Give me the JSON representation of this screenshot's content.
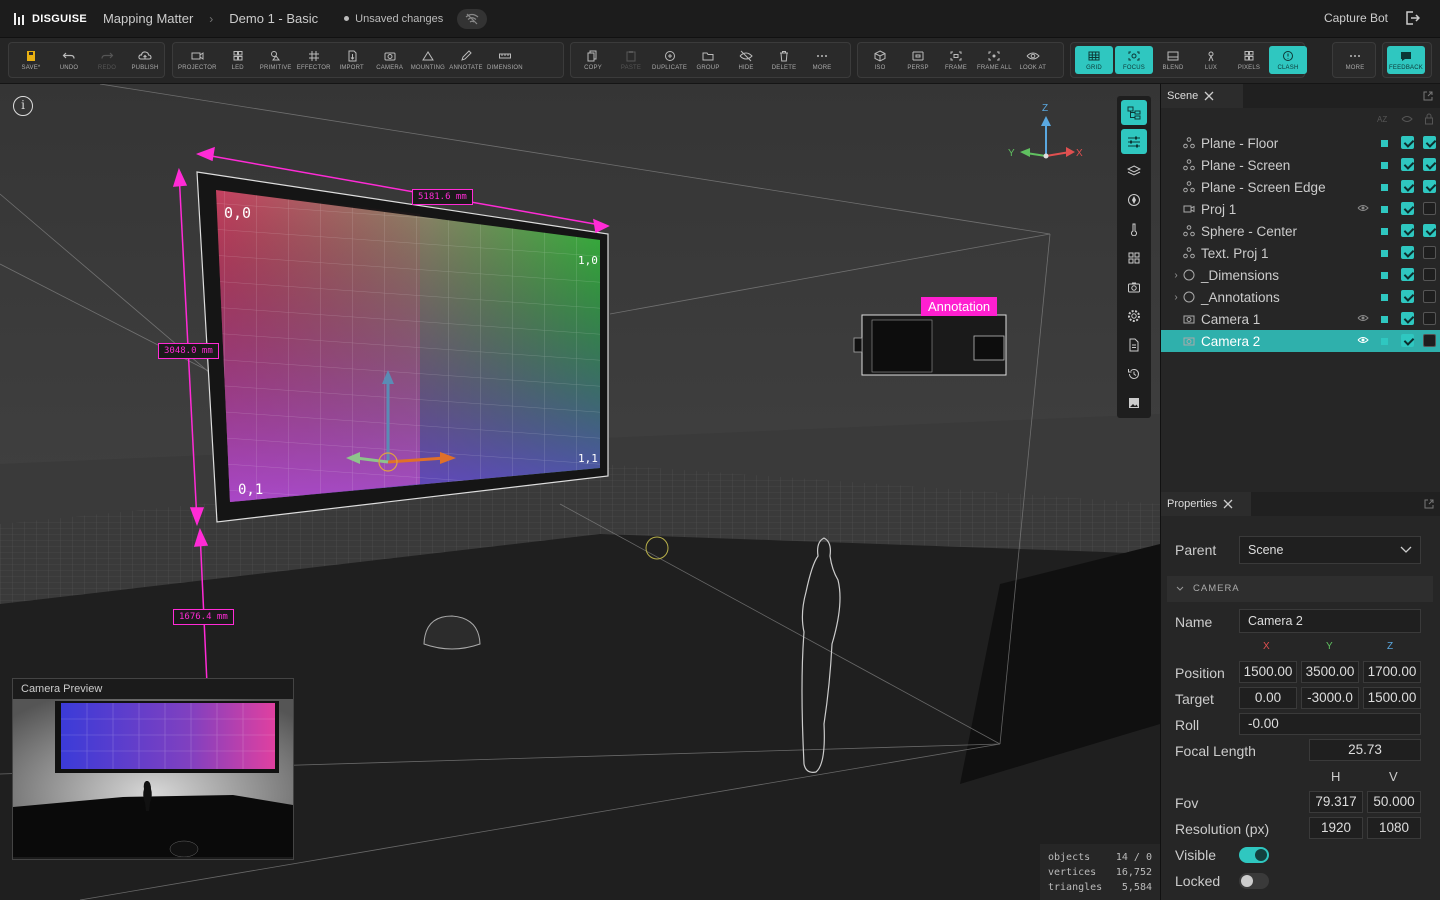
{
  "app": {
    "logo": "DISGUISE",
    "project": "Mapping Matter",
    "scene": "Demo 1 - Basic",
    "status": "Unsaved changes",
    "user": "Capture Bot"
  },
  "toolbar": {
    "file": [
      "SAVE*",
      "UNDO",
      "REDO",
      "PUBLISH"
    ],
    "create": [
      "PROJECTOR",
      "LED",
      "PRIMITIVE",
      "EFFECTOR",
      "IMPORT",
      "CAMERA",
      "MOUNTING",
      "ANNOTATE",
      "DIMENSION"
    ],
    "edit": [
      "COPY",
      "PASTE",
      "DUPLICATE",
      "GROUP",
      "HIDE",
      "DELETE",
      "MORE"
    ],
    "view": [
      "ISO",
      "PERSP",
      "FRAME",
      "FRAME ALL",
      "LOOK AT"
    ],
    "display": [
      "GRID",
      "FOCUS",
      "BLEND",
      "LUX",
      "PIXELS",
      "CLASH"
    ],
    "more": "MORE",
    "feedback": "FEEDBACK"
  },
  "viewport": {
    "dimensions": [
      "5181.6 mm",
      "3048.0 mm",
      "1676.4 mm"
    ],
    "annotation": "Annotation",
    "gizmo_axes": [
      "Z",
      "Y",
      "X"
    ],
    "screen_corner_labels": [
      "0,0",
      "1,0",
      "0,1",
      "1,1"
    ],
    "preview_title": "Camera Preview",
    "stats": [
      {
        "label": "objects",
        "value": "14 / 0"
      },
      {
        "label": "vertices",
        "value": "16,752"
      },
      {
        "label": "triangles",
        "value": "5,584"
      }
    ]
  },
  "scene_panel": {
    "tab": "Scene",
    "sort_label": "AZ",
    "items": [
      {
        "label": "Plane - Floor",
        "icon": "mesh-icon",
        "vis": true,
        "lock": true
      },
      {
        "label": "Plane - Screen",
        "icon": "mesh-icon",
        "vis": true,
        "lock": true
      },
      {
        "label": "Plane - Screen Edge",
        "icon": "mesh-icon",
        "vis": true,
        "lock": true
      },
      {
        "label": "Proj 1",
        "icon": "projector-icon",
        "eye": true,
        "vis": true,
        "lock": false
      },
      {
        "label": "Sphere - Center",
        "icon": "mesh-icon",
        "vis": true,
        "lock": true
      },
      {
        "label": "Text. Proj 1",
        "icon": "mesh-icon",
        "vis": true,
        "lock": false
      },
      {
        "label": "_Dimensions",
        "icon": "group-icon",
        "chevron": true,
        "vis": true,
        "lock": false
      },
      {
        "label": "_Annotations",
        "icon": "group-icon",
        "chevron": true,
        "vis": true,
        "lock": false
      },
      {
        "label": "Camera 1",
        "icon": "camera-icon",
        "eye": true,
        "vis": true,
        "lock": false
      },
      {
        "label": "Camera 2",
        "icon": "camera-icon",
        "eye": true,
        "vis": true,
        "lock": false,
        "selected": true
      }
    ]
  },
  "properties": {
    "tab": "Properties",
    "parent_label": "Parent",
    "parent_value": "Scene",
    "section": "CAMERA",
    "name_label": "Name",
    "name_value": "Camera 2",
    "axes": [
      "X",
      "Y",
      "Z"
    ],
    "position_label": "Position",
    "position": [
      "1500.00",
      "3500.00",
      "1700.00"
    ],
    "target_label": "Target",
    "target": [
      "0.00",
      "-3000.0",
      "1500.00"
    ],
    "roll_label": "Roll",
    "roll": "-0.00",
    "focal_label": "Focal Length",
    "focal": "25.73",
    "hv": [
      "H",
      "V"
    ],
    "fov_label": "Fov",
    "fov": [
      "79.317",
      "50.000"
    ],
    "res_label": "Resolution (px)",
    "res": [
      "1920",
      "1080"
    ],
    "visible_label": "Visible",
    "visible": true,
    "locked_label": "Locked",
    "locked": false
  },
  "colors": {
    "accent": "#2fc7c0",
    "dimension": "#ff2bd6",
    "annotation": "#ff1fd0"
  }
}
